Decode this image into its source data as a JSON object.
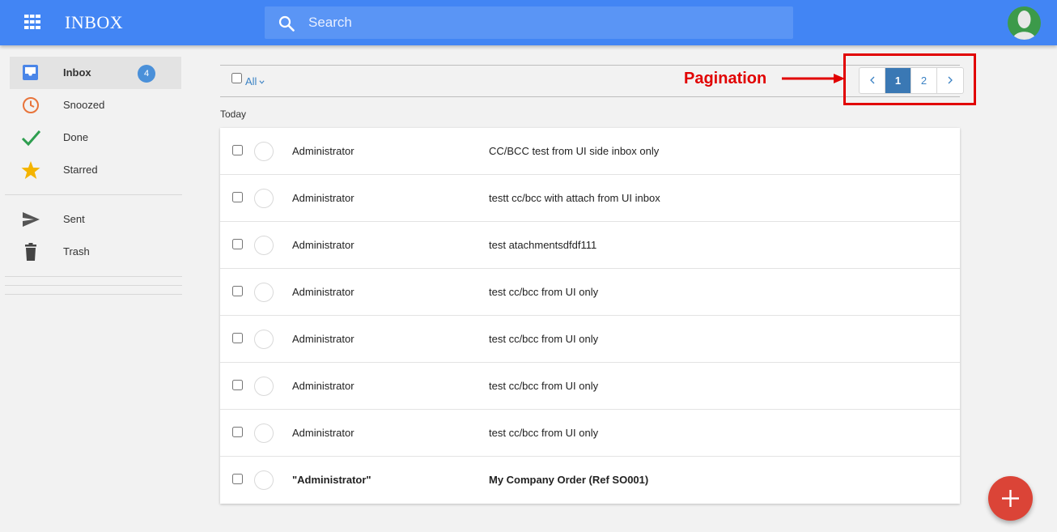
{
  "header": {
    "title": "INBOX",
    "search_placeholder": "Search"
  },
  "sidebar": {
    "items": [
      {
        "label": "Inbox",
        "icon": "inbox-icon",
        "badge": "4",
        "active": true
      },
      {
        "label": "Snoozed",
        "icon": "clock-icon"
      },
      {
        "label": "Done",
        "icon": "check-icon"
      },
      {
        "label": "Starred",
        "icon": "star-icon"
      },
      {
        "label": "Sent",
        "icon": "send-icon"
      },
      {
        "label": "Trash",
        "icon": "trash-icon"
      }
    ]
  },
  "toolbar": {
    "filter_label": "All"
  },
  "annotation": {
    "label": "Pagination",
    "color": "#e10000"
  },
  "pagination": {
    "pages": [
      "1",
      "2"
    ],
    "current": "1"
  },
  "section": {
    "label": "Today"
  },
  "messages": [
    {
      "sender": "Administrator",
      "subject": "CC/BCC test from UI side inbox only"
    },
    {
      "sender": "Administrator",
      "subject": "testt cc/bcc with attach from UI inbox"
    },
    {
      "sender": "Administrator",
      "subject": "test atachmentsdfdf111"
    },
    {
      "sender": "Administrator",
      "subject": "test cc/bcc from UI only"
    },
    {
      "sender": "Administrator",
      "subject": "test cc/bcc from UI only"
    },
    {
      "sender": "Administrator",
      "subject": "test cc/bcc from UI only"
    },
    {
      "sender": "Administrator",
      "subject": "test cc/bcc from UI only"
    },
    {
      "sender": "\"Administrator\"",
      "subject": "My Company Order (Ref SO001)",
      "unread": true
    }
  ],
  "colors": {
    "topbar": "#4285f4",
    "accent": "#3a78b4",
    "fab": "#db4437",
    "badge": "#4a90d9"
  }
}
